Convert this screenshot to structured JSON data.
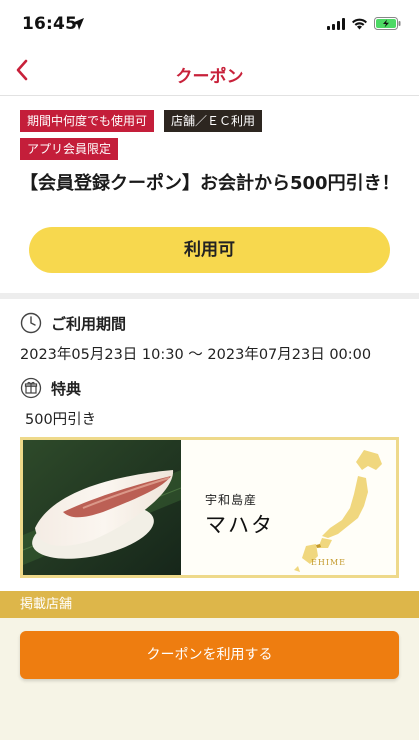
{
  "status_bar": {
    "time": "16:45",
    "icons": [
      "location-arrow-icon",
      "signal-icon",
      "wifi-icon",
      "battery-charging-icon"
    ]
  },
  "nav": {
    "title": "クーポン",
    "back_icon": "chevron-left-icon"
  },
  "coupon": {
    "tags": [
      "期間中何度でも使用可",
      "店舗／ＥＣ利用",
      "アプリ会員限定"
    ],
    "title": "【会員登録クーポン】お会計から500円引き！",
    "status": "利用可",
    "period_label": "ご利用期間",
    "period_value": "2023年05月23日 10:30 〜 2023年07月23日 00:00",
    "benefit_label": "特典",
    "benefit_value": "500円引き"
  },
  "banner": {
    "origin": "宇和島産",
    "fish": "マハタ",
    "region": "EHIME"
  },
  "stores_label": "掲載店舗",
  "use_button": "クーポンを利用する",
  "colors": {
    "accent_red": "#c8213a",
    "tag_red": "#c41e3a",
    "tag_dark": "#2d2620",
    "pill_yellow": "#f7d84e",
    "stores_gold": "#ddb64a",
    "button_orange": "#ee7d10"
  }
}
